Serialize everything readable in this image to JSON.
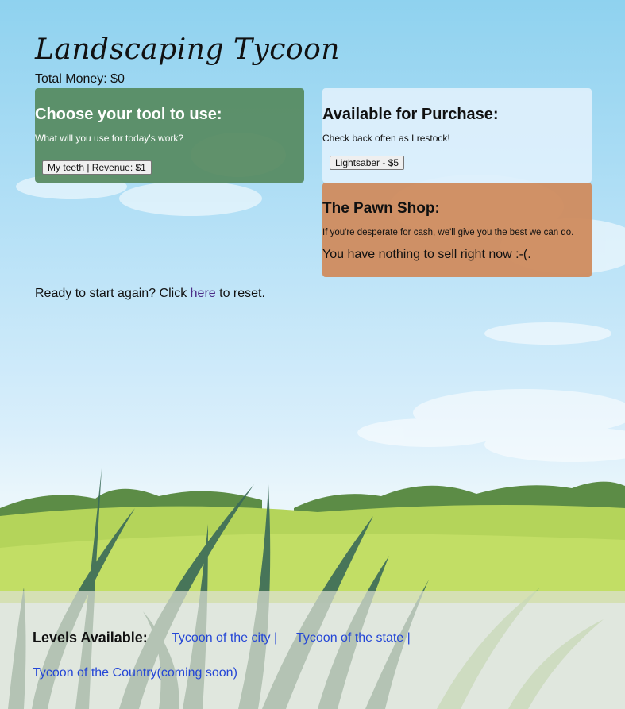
{
  "title": "Landscaping Tycoon",
  "money": {
    "label": "Total Money: ",
    "value": "$0"
  },
  "tools_panel": {
    "heading": "Choose your tool to use:",
    "subtitle": "What will you use for today's work?",
    "tool_button": "My teeth | Revenue: $1"
  },
  "store_panel": {
    "heading": "Available for Purchase:",
    "subtitle": "Check back often as I restock!",
    "item_button": "Lightsaber - $5"
  },
  "pawn_panel": {
    "heading": "The Pawn Shop:",
    "subtitle": "If you're desperate for cash, we'll give you the best we can do.",
    "empty_message": "You have nothing to sell right now :-(."
  },
  "reset": {
    "prefix": "Ready to start again? Click ",
    "link": "here",
    "suffix": " to reset."
  },
  "footer": {
    "levels_label": "Levels Available:",
    "links": [
      "Tycoon of the city |",
      "Tycoon of the state |",
      "Tycoon of the Country(coming soon)"
    ]
  },
  "colors": {
    "sky": "#8fd2ef",
    "tools_panel": "#568a60",
    "store_panel": "#def0fc",
    "pawn_panel": "#cf8c60",
    "grass": "#b8d860",
    "link": "#2446d6"
  }
}
